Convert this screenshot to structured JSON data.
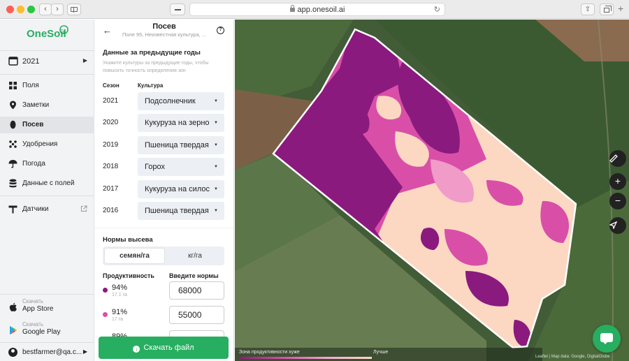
{
  "browser": {
    "url": "app.onesoil.ai"
  },
  "sidebar": {
    "logo": "OneSoil",
    "year": "2021",
    "nav": [
      {
        "label": "Поля",
        "icon": "fields-icon"
      },
      {
        "label": "Заметки",
        "icon": "pin-icon"
      },
      {
        "label": "Посев",
        "icon": "seed-icon",
        "active": true
      },
      {
        "label": "Удобрения",
        "icon": "fertilizer-icon"
      },
      {
        "label": "Погода",
        "icon": "umbrella-icon"
      },
      {
        "label": "Данные с полей",
        "icon": "database-icon"
      }
    ],
    "sensors": "Датчики",
    "stores": [
      {
        "small": "Скачать",
        "big": "App Store"
      },
      {
        "small": "Скачать",
        "big": "Google Play"
      }
    ],
    "account": "bestfarmer@qa.c..."
  },
  "panel": {
    "title": "Посев",
    "subtitle": "Поле 95, Неизвестная культура, ...",
    "history_title": "Данные за предыдущие годы",
    "history_desc": "Укажите культуры за предыдущие годы, чтобы повысить точность определения зон",
    "col_season": "Сезон",
    "col_crop": "Культура",
    "rows": [
      {
        "season": "2021",
        "crop": "Подсолнечник"
      },
      {
        "season": "2020",
        "crop": "Кукуруза на зерно"
      },
      {
        "season": "2019",
        "crop": "Пшеница твердая"
      },
      {
        "season": "2018",
        "crop": "Горох"
      },
      {
        "season": "2017",
        "crop": "Кукуруза на силос"
      },
      {
        "season": "2016",
        "crop": "Пшеница твердая"
      }
    ],
    "rates_title": "Нормы высева",
    "unit_on": "семян/га",
    "unit_off": "кг/га",
    "col_productivity": "Продуктивность",
    "col_norm": "Введите нормы",
    "zones": [
      {
        "pct": "94%",
        "ha": "17.1 га",
        "norm": "68000",
        "color": "#8b1a7e"
      },
      {
        "pct": "91%",
        "ha": "17 га",
        "norm": "55000",
        "color": "#d94fa8"
      },
      {
        "pct": "89%",
        "ha": "",
        "norm": "",
        "color": "#f3a7cf"
      }
    ],
    "download": "Скачать файл"
  },
  "map": {
    "legend_low": "Зона продуктивности хуже",
    "legend_high": "Лучше",
    "attribution": "Leaflet | Map data: Google, DigitalGlobe",
    "zone_colors": {
      "low": "#8b1a7e",
      "mid": "#d94fa8",
      "midlight": "#f09bc8",
      "high": "#fcd8c2"
    },
    "controls": [
      "ruler-icon",
      "zoom-in-icon",
      "zoom-out-icon",
      "locate-icon"
    ]
  }
}
